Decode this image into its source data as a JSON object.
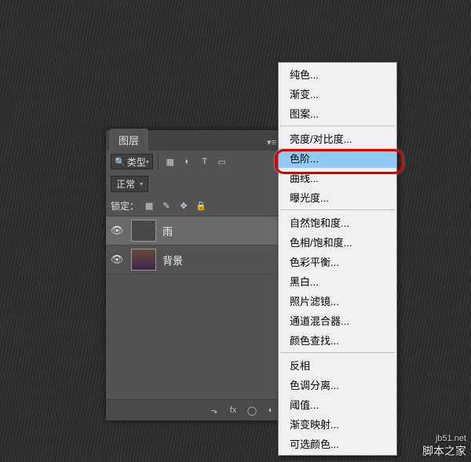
{
  "panel": {
    "tab": "图层",
    "filter_label": "类型",
    "blend_mode": "正常",
    "lock_label": "锁定：",
    "layers": [
      {
        "visible": true,
        "name": "雨",
        "selected": true,
        "thumb": "rain"
      },
      {
        "visible": true,
        "name": "背景",
        "selected": false,
        "thumb": "photo"
      }
    ]
  },
  "menu": {
    "group1": [
      "纯色...",
      "渐变...",
      "图案..."
    ],
    "group2": [
      "亮度/对比度...",
      "色阶...",
      "曲线...",
      "曝光度..."
    ],
    "group3": [
      "自然饱和度...",
      "色相/饱和度...",
      "色彩平衡...",
      "黑白...",
      "照片滤镜...",
      "通道混合器...",
      "颜色查找..."
    ],
    "group4": [
      "反相",
      "色调分离...",
      "阈值...",
      "渐变映射...",
      "可选颜色..."
    ],
    "highlighted": "色阶..."
  },
  "watermark": {
    "site": "jb51.net",
    "name": "脚本之家"
  }
}
